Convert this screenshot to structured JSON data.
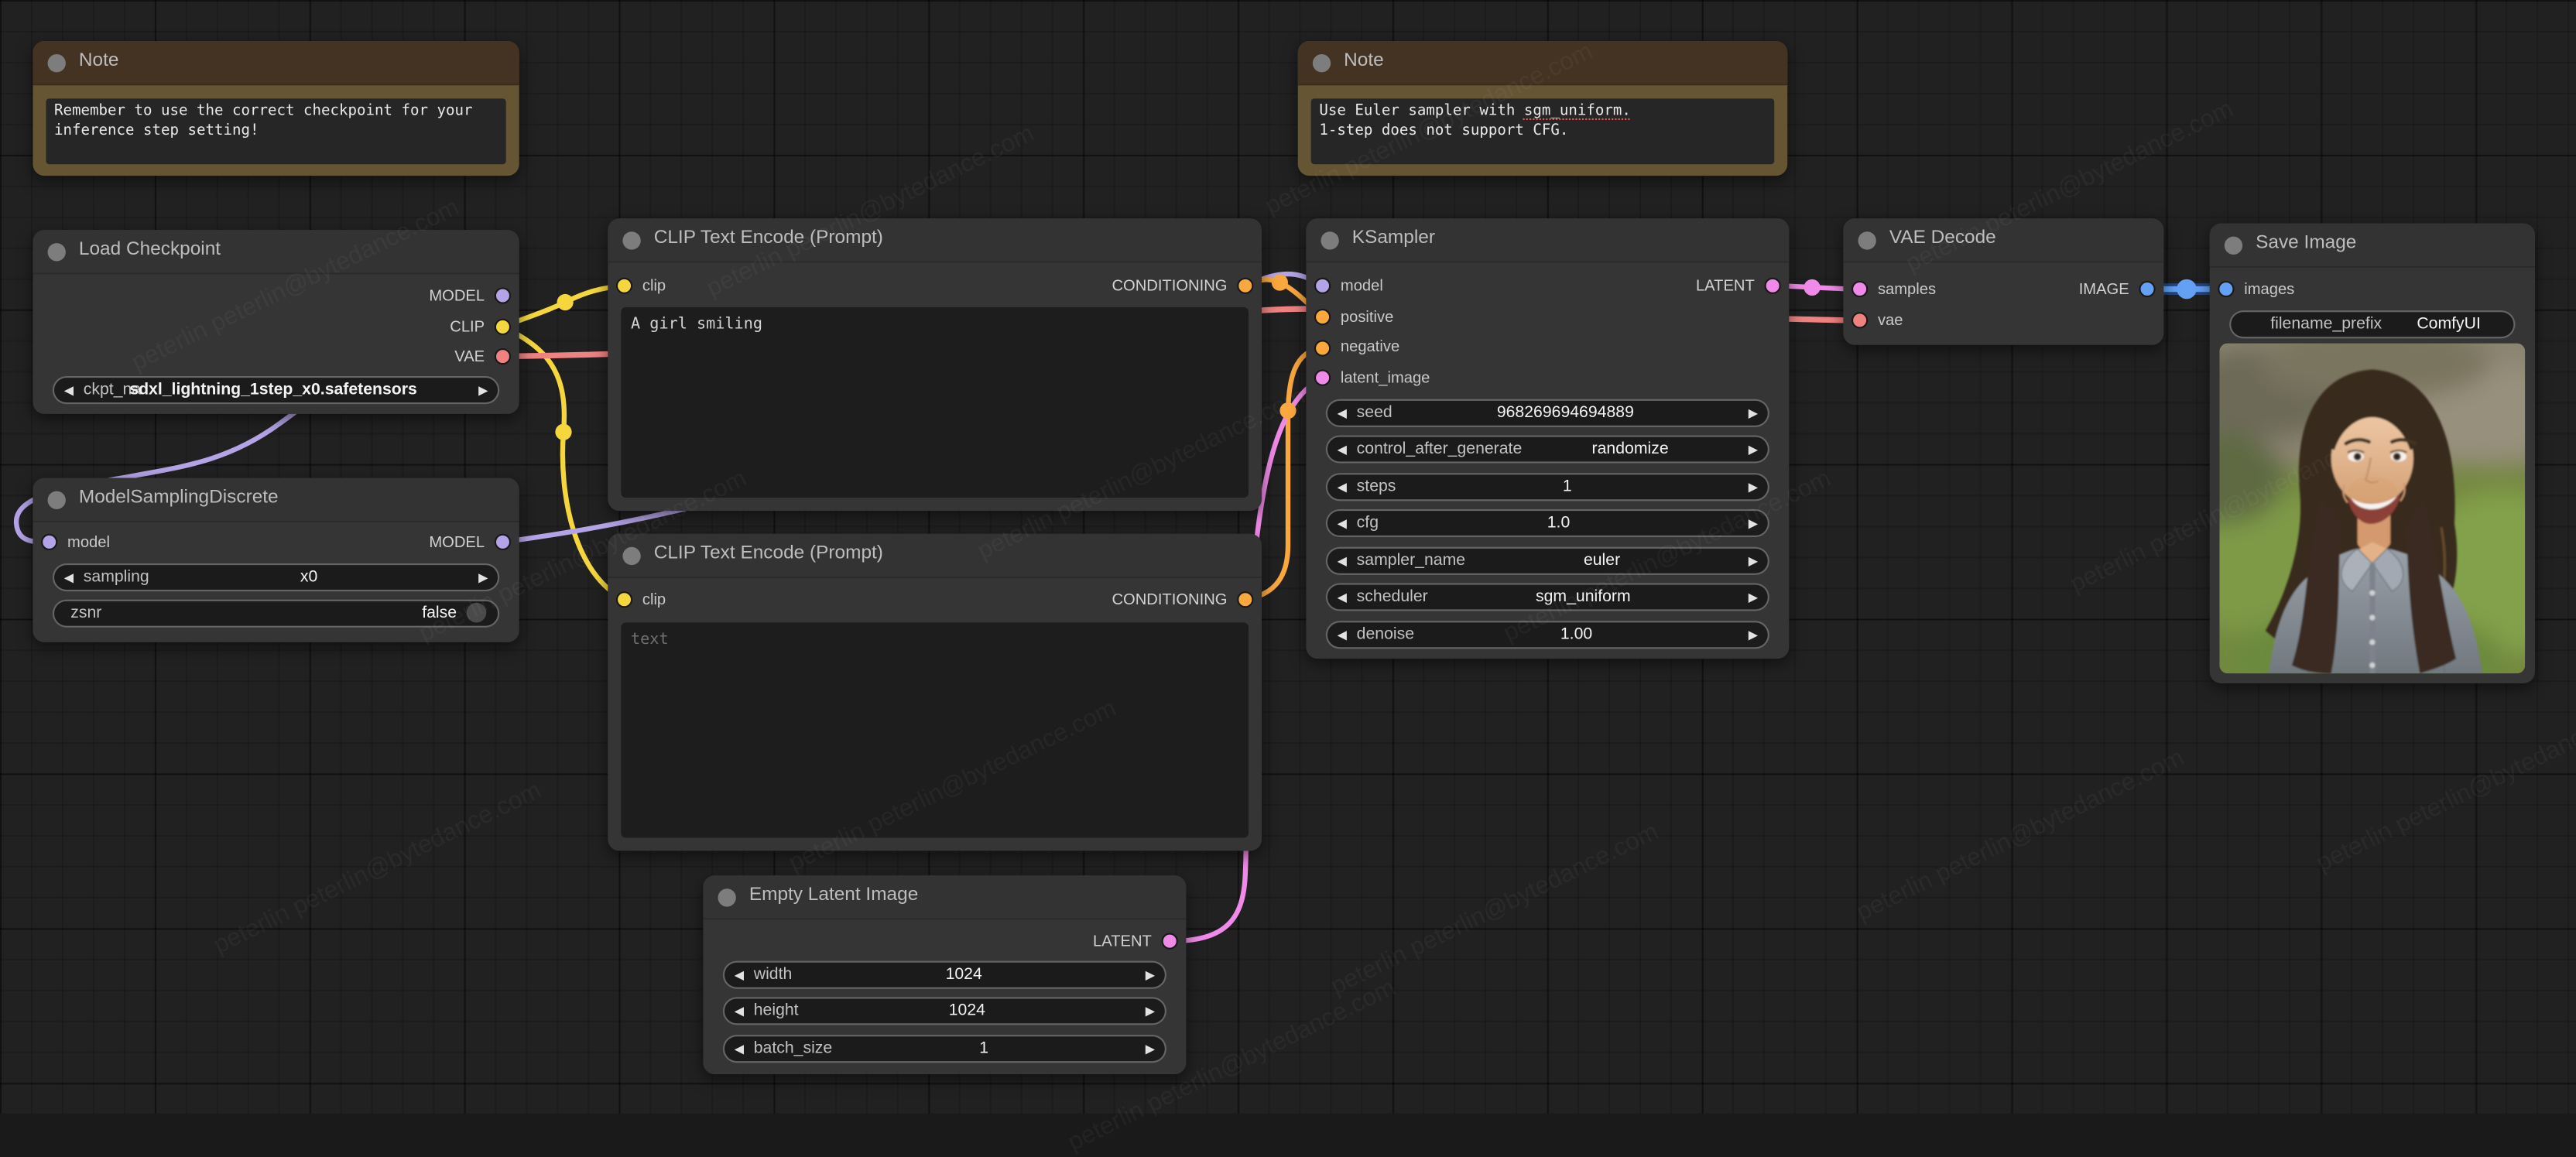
{
  "canvas": {
    "background": "#212121",
    "watermark": "peterlin peterlin@bytedance.com"
  },
  "icons": {
    "prev_arrow": "◀",
    "next_arrow": "▶"
  },
  "palette": {
    "model": "#b4a3e6",
    "clip": "#f5d73d",
    "vae": "#ef8181",
    "conditioning": "#faa73e",
    "latent": "#f08ae8",
    "image": "#64a1f4",
    "image_glow": "#2f66c4",
    "title_dot": "#7d7d7d",
    "knob": "#4a4a4a"
  },
  "nodes": {
    "note_left": {
      "title": "Note",
      "text": "Remember to use the correct checkpoint for your\ninference step setting!"
    },
    "note_right": {
      "title": "Note",
      "text_pre": "Use Euler sampler with ",
      "text_underlined": "sgm_uniform.",
      "text_line2": "1-step does not support CFG."
    },
    "load_checkpoint": {
      "title": "Load Checkpoint",
      "outputs": [
        {
          "label": "MODEL"
        },
        {
          "label": "CLIP"
        },
        {
          "label": "VAE"
        }
      ],
      "widgets": [
        {
          "label": "ckpt_na",
          "value": "sdxl_lightning_1step_x0.safetensors"
        }
      ]
    },
    "model_sampling": {
      "title": "ModelSamplingDiscrete",
      "inputs": [
        {
          "label": "model"
        }
      ],
      "outputs": [
        {
          "label": "MODEL"
        }
      ],
      "widgets": [
        {
          "label": "sampling",
          "value": "x0"
        },
        {
          "label": "zsnr",
          "value": "false"
        }
      ]
    },
    "clip_positive": {
      "title": "CLIP Text Encode (Prompt)",
      "inputs": [
        {
          "label": "clip"
        }
      ],
      "outputs": [
        {
          "label": "CONDITIONING"
        }
      ],
      "prompt": "A girl smiling"
    },
    "clip_negative": {
      "title": "CLIP Text Encode (Prompt)",
      "inputs": [
        {
          "label": "clip"
        }
      ],
      "outputs": [
        {
          "label": "CONDITIONING"
        }
      ],
      "prompt": "",
      "placeholder": "text"
    },
    "empty_latent": {
      "title": "Empty Latent Image",
      "outputs": [
        {
          "label": "LATENT"
        }
      ],
      "widgets": [
        {
          "label": "width",
          "value": "1024"
        },
        {
          "label": "height",
          "value": "1024"
        },
        {
          "label": "batch_size",
          "value": "1"
        }
      ]
    },
    "ksampler": {
      "title": "KSampler",
      "inputs": [
        {
          "label": "model"
        },
        {
          "label": "positive"
        },
        {
          "label": "negative"
        },
        {
          "label": "latent_image"
        }
      ],
      "outputs": [
        {
          "label": "LATENT"
        }
      ],
      "widgets": [
        {
          "label": "seed",
          "value": "968269694694889"
        },
        {
          "label": "control_after_generate",
          "value": "randomize"
        },
        {
          "label": "steps",
          "value": "1"
        },
        {
          "label": "cfg",
          "value": "1.0"
        },
        {
          "label": "sampler_name",
          "value": "euler"
        },
        {
          "label": "scheduler",
          "value": "sgm_uniform"
        },
        {
          "label": "denoise",
          "value": "1.00"
        }
      ]
    },
    "vae_decode": {
      "title": "VAE Decode",
      "inputs": [
        {
          "label": "samples"
        },
        {
          "label": "vae"
        }
      ],
      "outputs": [
        {
          "label": "IMAGE"
        }
      ]
    },
    "save_image": {
      "title": "Save Image",
      "inputs": [
        {
          "label": "images"
        }
      ],
      "widgets": [
        {
          "label": "filename_prefix",
          "value": "ComfyUI"
        }
      ]
    }
  }
}
